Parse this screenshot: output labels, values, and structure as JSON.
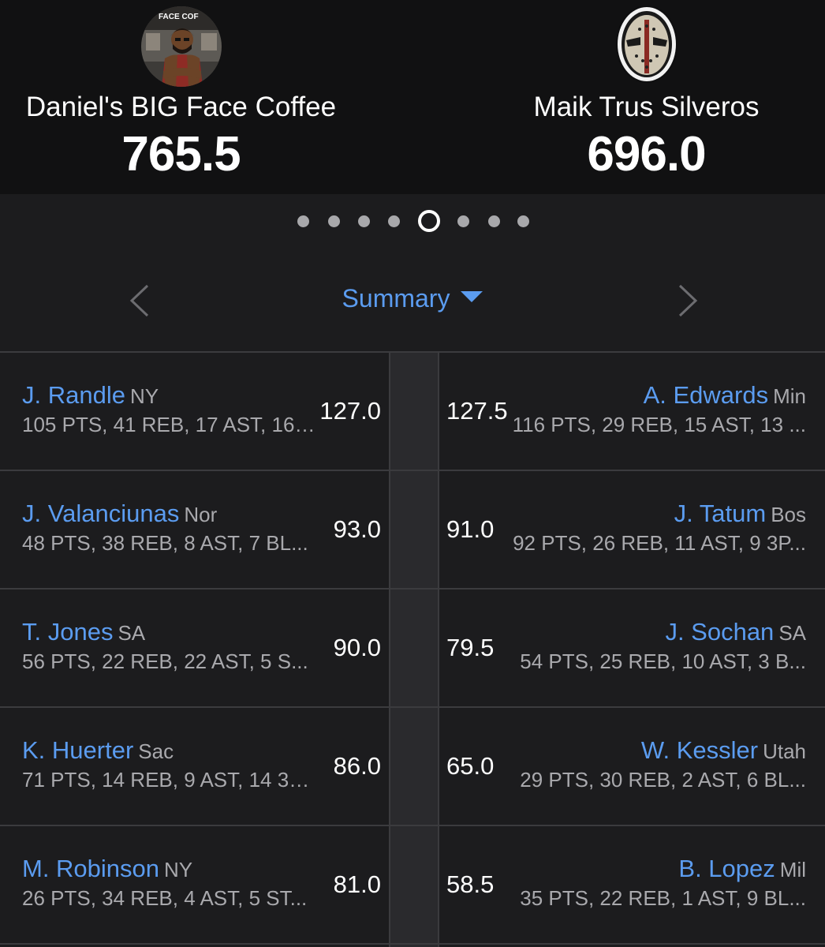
{
  "teams": {
    "home": {
      "name": "Daniel's BIG Face Coffee",
      "score": "765.5",
      "avatar_icon": "barista-avatar",
      "avatar_text": "FACE COF"
    },
    "away": {
      "name": "Maik Trus Silveros",
      "score": "696.0",
      "avatar_icon": "hockey-mask-avatar"
    }
  },
  "pager": {
    "count": 8,
    "active_index": 4
  },
  "nav": {
    "title": "Summary",
    "prev_icon": "chevron-left-icon",
    "next_icon": "chevron-right-icon",
    "accent": "#5b9cf0"
  },
  "rows": [
    {
      "home": {
        "name": "J. Randle",
        "team": "NY",
        "stats": "105 PTS, 41 REB, 17 AST, 16 ...",
        "points": "127.0"
      },
      "away": {
        "name": "A. Edwards",
        "team": "Min",
        "stats": "116 PTS, 29 REB, 15 AST, 13 ...",
        "points": "127.5"
      }
    },
    {
      "home": {
        "name": "J. Valanciunas",
        "team": "Nor",
        "stats": "48 PTS, 38 REB, 8 AST, 7 BL...",
        "points": "93.0"
      },
      "away": {
        "name": "J. Tatum",
        "team": "Bos",
        "stats": "92 PTS, 26 REB, 11 AST, 9 3P...",
        "points": "91.0"
      }
    },
    {
      "home": {
        "name": "T. Jones",
        "team": "SA",
        "stats": "56 PTS, 22 REB, 22 AST, 5 S...",
        "points": "90.0"
      },
      "away": {
        "name": "J. Sochan",
        "team": "SA",
        "stats": "54 PTS, 25 REB, 10 AST, 3 B...",
        "points": "79.5"
      }
    },
    {
      "home": {
        "name": "K. Huerter",
        "team": "Sac",
        "stats": "71 PTS, 14 REB, 9 AST, 14 3P...",
        "points": "86.0"
      },
      "away": {
        "name": "W. Kessler",
        "team": "Utah",
        "stats": "29 PTS, 30 REB, 2 AST, 6 BL...",
        "points": "65.0"
      }
    },
    {
      "home": {
        "name": "M. Robinson",
        "team": "NY",
        "stats": "26 PTS, 34 REB, 4 AST, 5 ST...",
        "points": "81.0"
      },
      "away": {
        "name": "B. Lopez",
        "team": "Mil",
        "stats": "35 PTS, 22 REB, 1 AST, 9 BL...",
        "points": "58.5"
      }
    }
  ]
}
